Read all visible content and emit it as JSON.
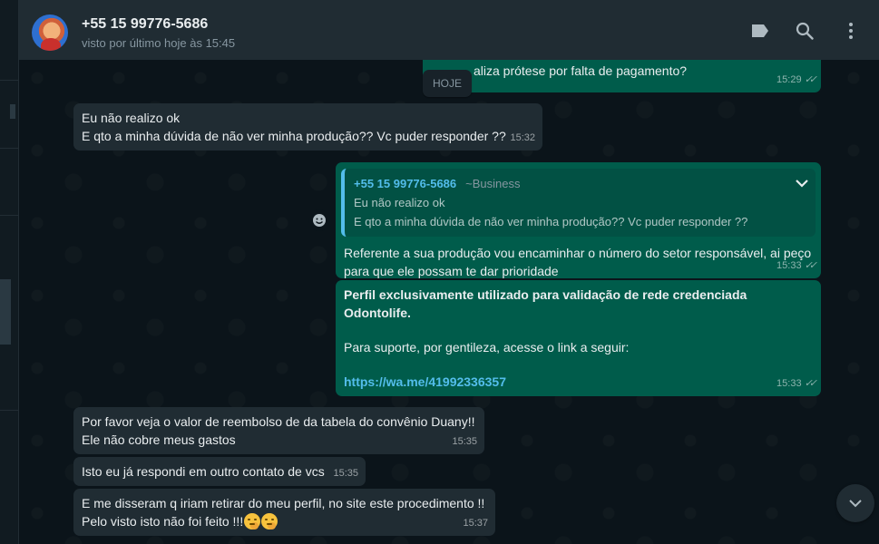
{
  "contact": {
    "name": "+55 15 99776-5686",
    "status": "visto por último hoje às 15:45"
  },
  "icons": {
    "label": "label-icon",
    "search": "search-icon",
    "menu": "more-vertical-icon",
    "emoji": "emoji-icon",
    "scroll": "chevron-down-icon"
  },
  "colors": {
    "incoming": "#202c33",
    "outgoing": "#005c4b",
    "link": "#53bdeb",
    "background": "#0b141a"
  },
  "date_chip": "HOJE",
  "messages": [
    {
      "dir": "out",
      "text": "aliza prótese por falta de pagamento?",
      "time": "15:29"
    },
    {
      "dir": "in",
      "lines": [
        "Eu não realizo ok",
        "E qto a minha dúvida de não ver minha produção?? Vc puder responder ??"
      ],
      "time": "15:32"
    },
    {
      "dir": "out",
      "quote": {
        "name": "+55 15 99776-5686",
        "tag": "~Business",
        "lines": [
          "Eu não realizo ok",
          "E qto a minha dúvida de não ver minha produção?? Vc puder responder ??"
        ]
      },
      "lines": [
        "Referente a sua produção vou encaminhar o número do setor responsável, ai peço",
        "para que ele possam te dar prioridade"
      ],
      "time": "15:33"
    },
    {
      "dir": "out",
      "bold_lines": [
        "Perfil exclusivamente utilizado para validação de rede credenciada",
        "Odontolife."
      ],
      "body": "Para suporte, por gentileza, acesse o link a seguir:",
      "link": "https://wa.me/41992336357",
      "time": "15:33"
    },
    {
      "dir": "in",
      "lines": [
        "Por favor veja o valor de reembolso de da tabela do convênio Duany!!",
        "Ele não cobre meus gastos"
      ],
      "time": "15:35"
    },
    {
      "dir": "in",
      "text": "Isto eu já respondi em outro contato de vcs",
      "time": "15:35"
    },
    {
      "dir": "in",
      "lines": [
        "E me disseram q iriam retirar do meu perfil, no site este procedimento !!",
        "Pelo visto isto não foi feito !!!"
      ],
      "time": "15:37"
    }
  ]
}
